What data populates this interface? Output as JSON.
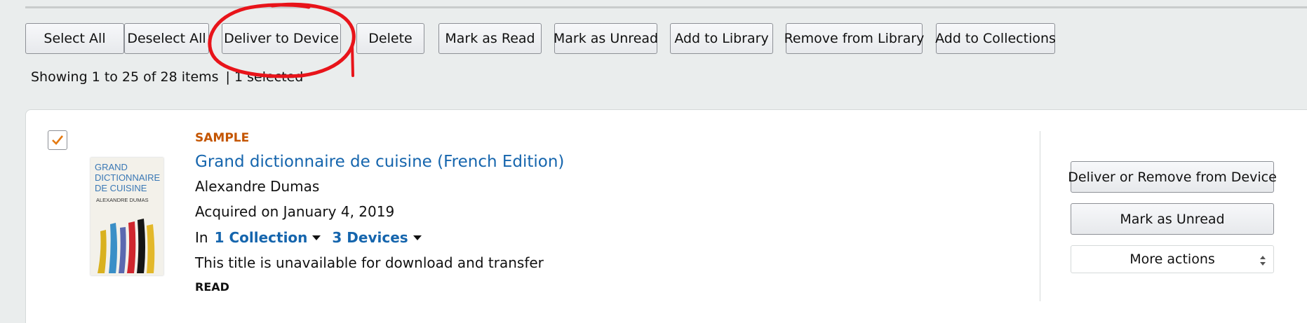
{
  "toolbar": {
    "buttons": [
      {
        "label": "Select All"
      },
      {
        "label": "Deselect All"
      },
      {
        "label": "Deliver to Device"
      },
      {
        "label": "Delete"
      },
      {
        "label": "Mark as Read"
      },
      {
        "label": "Mark as Unread"
      },
      {
        "label": "Add to Library"
      },
      {
        "label": "Remove from Library"
      },
      {
        "label": "Add to Collections"
      }
    ]
  },
  "status": {
    "showing": "Showing 1 to 25 of 28 items",
    "selected": "| 1 selected"
  },
  "item": {
    "checked": true,
    "badge": "SAMPLE",
    "title": "Grand dictionnaire de cuisine (French Edition)",
    "author": "Alexandre Dumas",
    "acquired": "Acquired on January 4, 2019",
    "in_label": "In",
    "collections": "1 Collection",
    "devices": "3 Devices",
    "availability": "This title is unavailable for download and transfer",
    "read_status": "READ",
    "cover": {
      "title": "GRAND DICTIONNAIRE DE CUISINE",
      "author": "ALEXANDRE DUMAS"
    },
    "actions": {
      "deliver": "Deliver or Remove from Device",
      "mark_unread": "Mark as Unread",
      "more": "More actions"
    }
  },
  "colors": {
    "accent_orange": "#c45500",
    "link_blue": "#1565ad",
    "annotation_red": "#e8141a",
    "page_bg": "#eaeded"
  }
}
